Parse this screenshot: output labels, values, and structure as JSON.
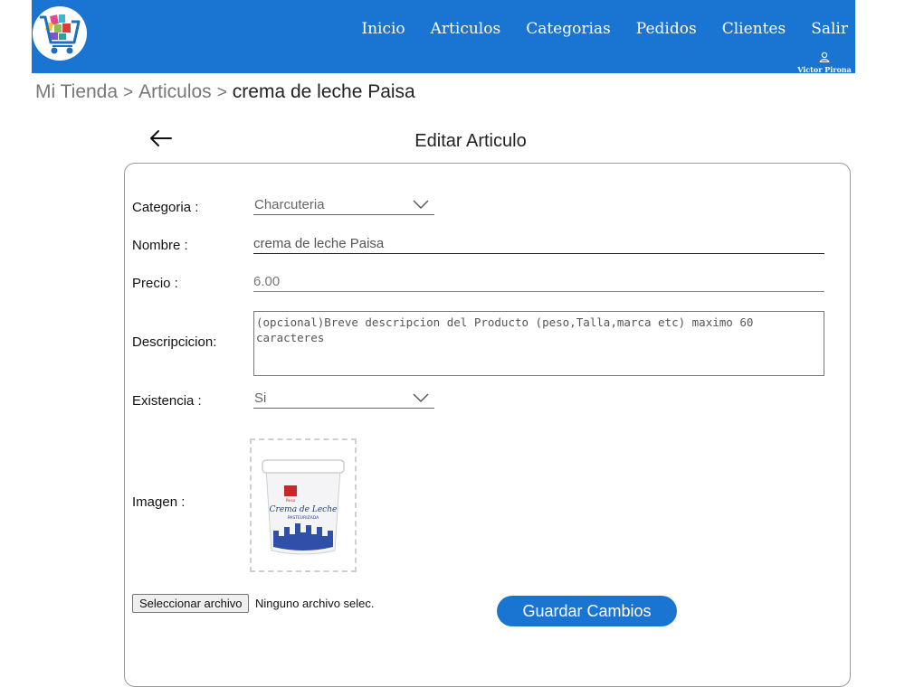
{
  "nav": {
    "logo_icon": "shopping-cart-logo",
    "items": [
      "Inicio",
      "Articulos",
      "Categorias",
      "Pedidos",
      "Clientes",
      "Salir"
    ],
    "user_icon": "user-icon",
    "user_name": "Victor Pirona",
    "background": "#1a74d2"
  },
  "breadcrumb": {
    "items": [
      "Mi Tienda",
      "Articulos"
    ],
    "separator": ">",
    "current": "crema de leche Paisa"
  },
  "page": {
    "back_icon": "arrow-left-icon",
    "title": "Editar Articulo"
  },
  "form": {
    "categoria_label": "Categoria :",
    "categoria_value": "Charcuteria",
    "nombre_label": "Nombre :",
    "nombre_value": "crema de leche Paisa",
    "precio_label": "Precio :",
    "precio_value": "6.00",
    "descripcion_label": "Descripcicion:",
    "descripcion_placeholder": "(opcional)Breve descripcion del Producto (peso,Talla,marca etc) maximo 60 caracteres",
    "existencia_label": "Existencia :",
    "existencia_value": "Si",
    "imagen_label": "Imagen :",
    "product_image": {
      "brand": "Paisa",
      "product_line1": "Crema de Leche",
      "product_line2": "PASTEURIZADA"
    },
    "file_button": "Seleccionar archivo",
    "file_status": "Ninguno archivo selec.",
    "save_button": "Guardar Cambios"
  }
}
